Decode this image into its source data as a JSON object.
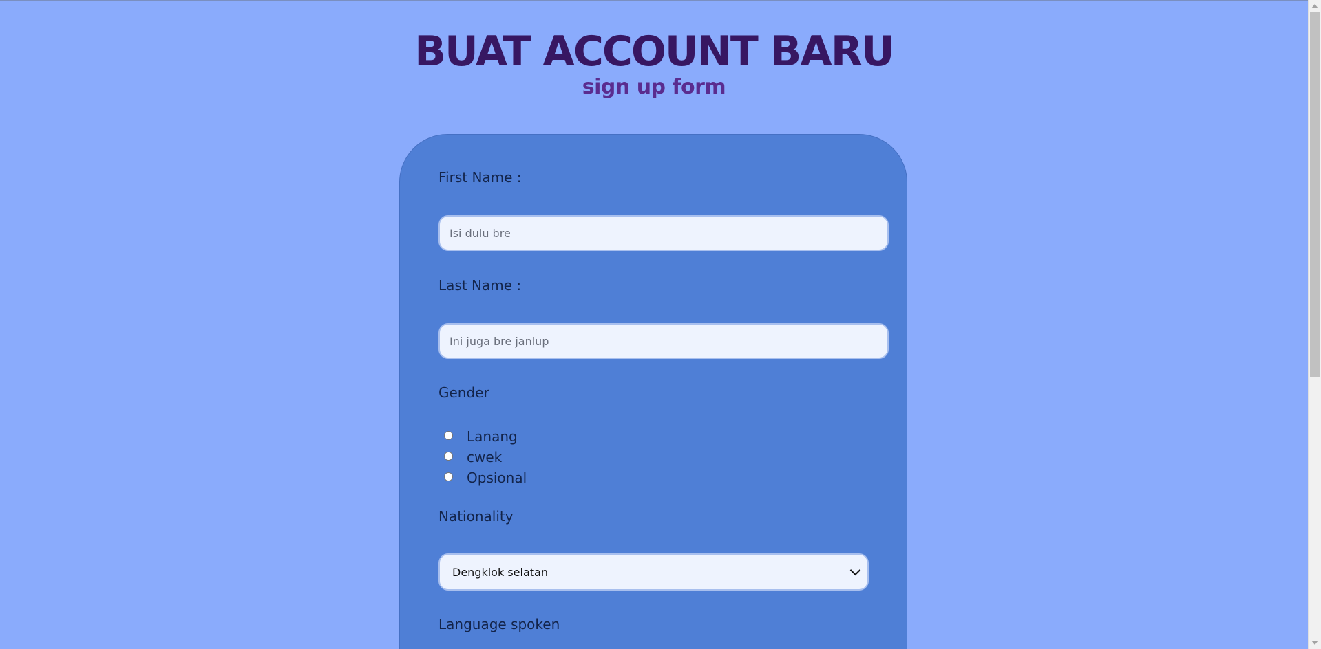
{
  "header": {
    "title": "BUAT ACCOUNT BARU",
    "subtitle": "sign up form"
  },
  "form": {
    "first_name": {
      "label": "First Name :",
      "placeholder": "Isi dulu bre",
      "value": ""
    },
    "last_name": {
      "label": "Last Name :",
      "placeholder": "Ini juga bre janlup",
      "value": ""
    },
    "gender": {
      "label": "Gender",
      "options": [
        "Lanang",
        "cwek",
        "Opsional"
      ]
    },
    "nationality": {
      "label": "Nationality",
      "selected": "Dengklok selatan"
    },
    "language": {
      "label": "Language spoken"
    }
  },
  "colors": {
    "background": "#8aabfc",
    "card": "#4f7fd6",
    "title": "#371762",
    "subtitle": "#5a2c8f"
  },
  "icons": {
    "select_arrow": "chevron-down-icon"
  }
}
